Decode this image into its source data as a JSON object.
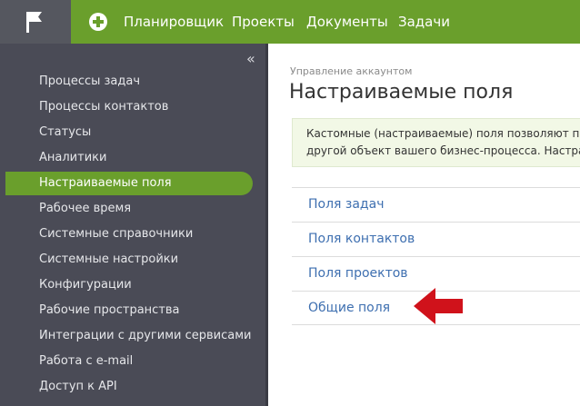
{
  "colors": {
    "accent": "#6a9f2c",
    "sidebar": "#4a4b56",
    "link": "#3e6fb0",
    "annotation_arrow": "#d0121b"
  },
  "topbar": {
    "logo_icon": "flag-icon",
    "add_icon": "plus-circle-icon",
    "nav": [
      "Планировщик",
      "Проекты",
      "Документы",
      "Задачи"
    ]
  },
  "sidebar": {
    "collapse_icon": "double-chevron-left-icon",
    "collapse_glyph": "«",
    "items": [
      {
        "label": "Процессы задач",
        "active": false
      },
      {
        "label": "Процессы контактов",
        "active": false
      },
      {
        "label": "Статусы",
        "active": false
      },
      {
        "label": "Аналитики",
        "active": false
      },
      {
        "label": "Настраиваемые поля",
        "active": true
      },
      {
        "label": "Рабочее время",
        "active": false
      },
      {
        "label": "Системные справочники",
        "active": false
      },
      {
        "label": "Системные настройки",
        "active": false
      },
      {
        "label": "Конфигурации",
        "active": false
      },
      {
        "label": "Рабочие пространства",
        "active": false
      },
      {
        "label": "Интеграции с другими сервисами",
        "active": false
      },
      {
        "label": "Работа с e-mail",
        "active": false
      },
      {
        "label": "Доступ к API",
        "active": false
      }
    ]
  },
  "main": {
    "breadcrumb": "Управление аккаунтом",
    "title": "Настраиваемые поля",
    "info_lines": [
      "Кастомные (настраиваемые) поля позволяют пр",
      "другой объект вашего бизнес-процесса. Настра"
    ],
    "links": [
      "Поля задач",
      "Поля контактов",
      "Поля проектов",
      "Общие поля"
    ],
    "annotation_icon": "red-arrow-left-icon"
  }
}
